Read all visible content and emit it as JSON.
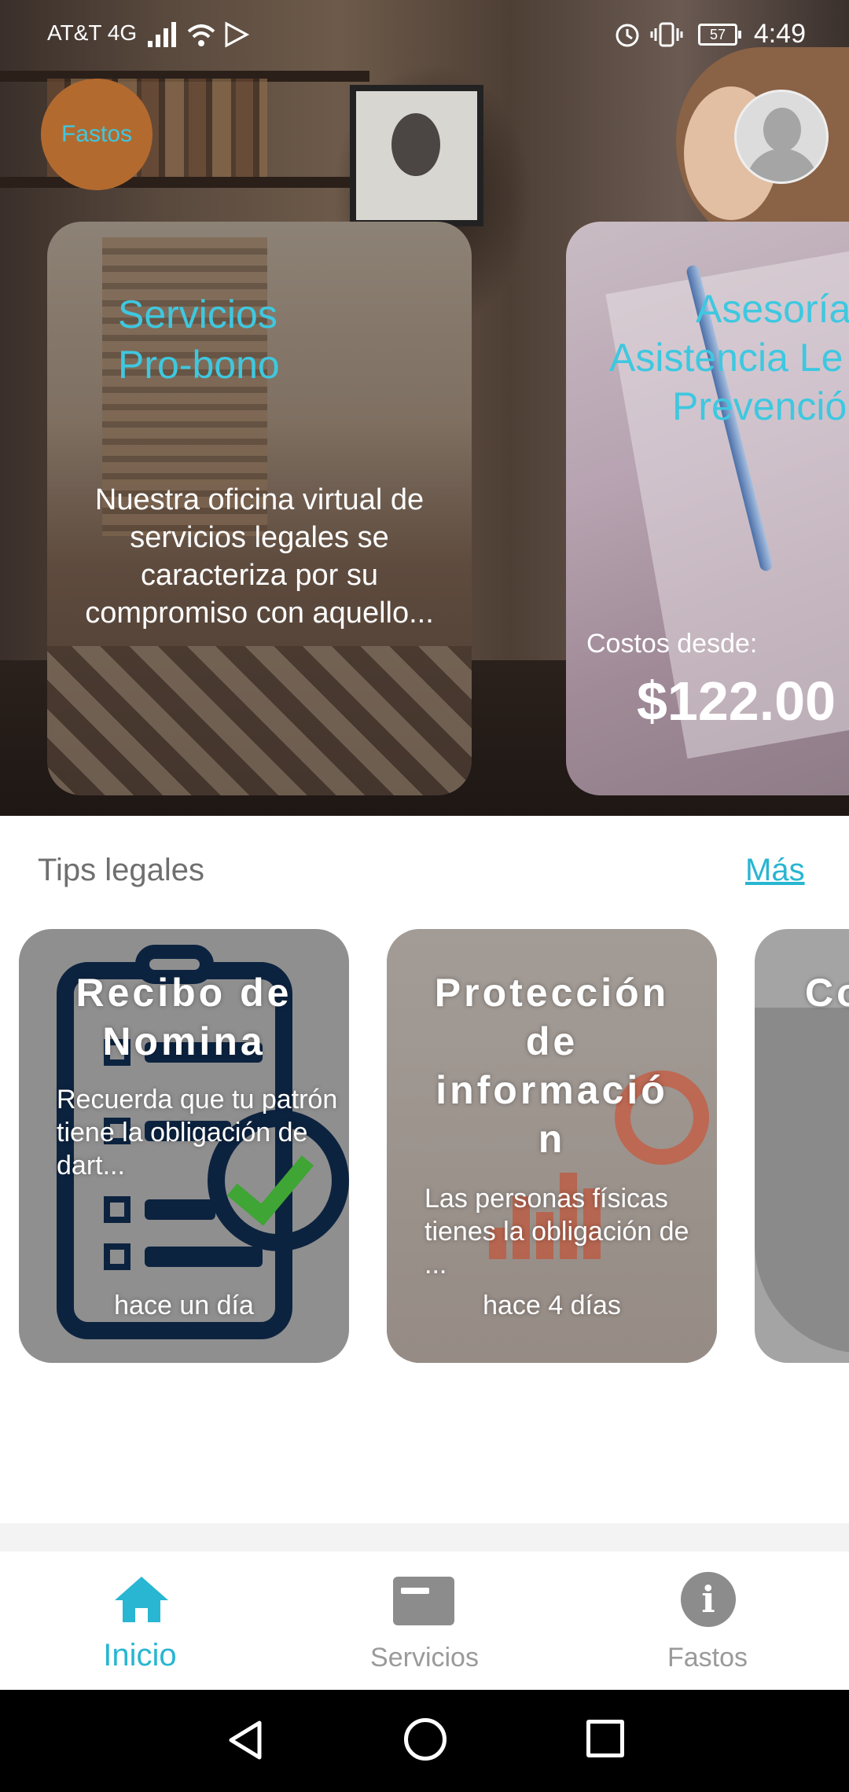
{
  "status_bar": {
    "carrier": "AT&T 4G",
    "battery": "57",
    "time": "4:49"
  },
  "header": {
    "logo_text": "Fastos"
  },
  "service_cards": [
    {
      "title_line1": "Servicios",
      "title_line2": "Pro-bono",
      "description": "Nuestra oficina virtual de servicios legales se caracteriza por su compromiso con aquello..."
    },
    {
      "title_line1": "Asesoría",
      "title_line2": "Asistencia Le",
      "title_line3": "Prevenció",
      "cost_label": "Costos desde:",
      "cost_value": "$122.00"
    }
  ],
  "tips": {
    "title": "Tips legales",
    "more": "Más",
    "items": [
      {
        "title": "Recibo de Nomina",
        "description": "Recuerda que tu patrón tiene la obligación de dart...",
        "time": "hace un día"
      },
      {
        "title": "Protección de informació n",
        "description": "Las personas físicas tienes la obligación de ...",
        "time": "hace 4 días"
      },
      {
        "title": "Co"
      }
    ]
  },
  "bottom_nav": {
    "items": [
      {
        "label": "Inicio",
        "active": true
      },
      {
        "label": "Servicios",
        "active": false
      },
      {
        "label": "Fastos",
        "active": false
      }
    ]
  },
  "colors": {
    "accent": "#28b6d2",
    "logo_bg": "#b36a2f",
    "inactive": "#9a9a9a"
  }
}
